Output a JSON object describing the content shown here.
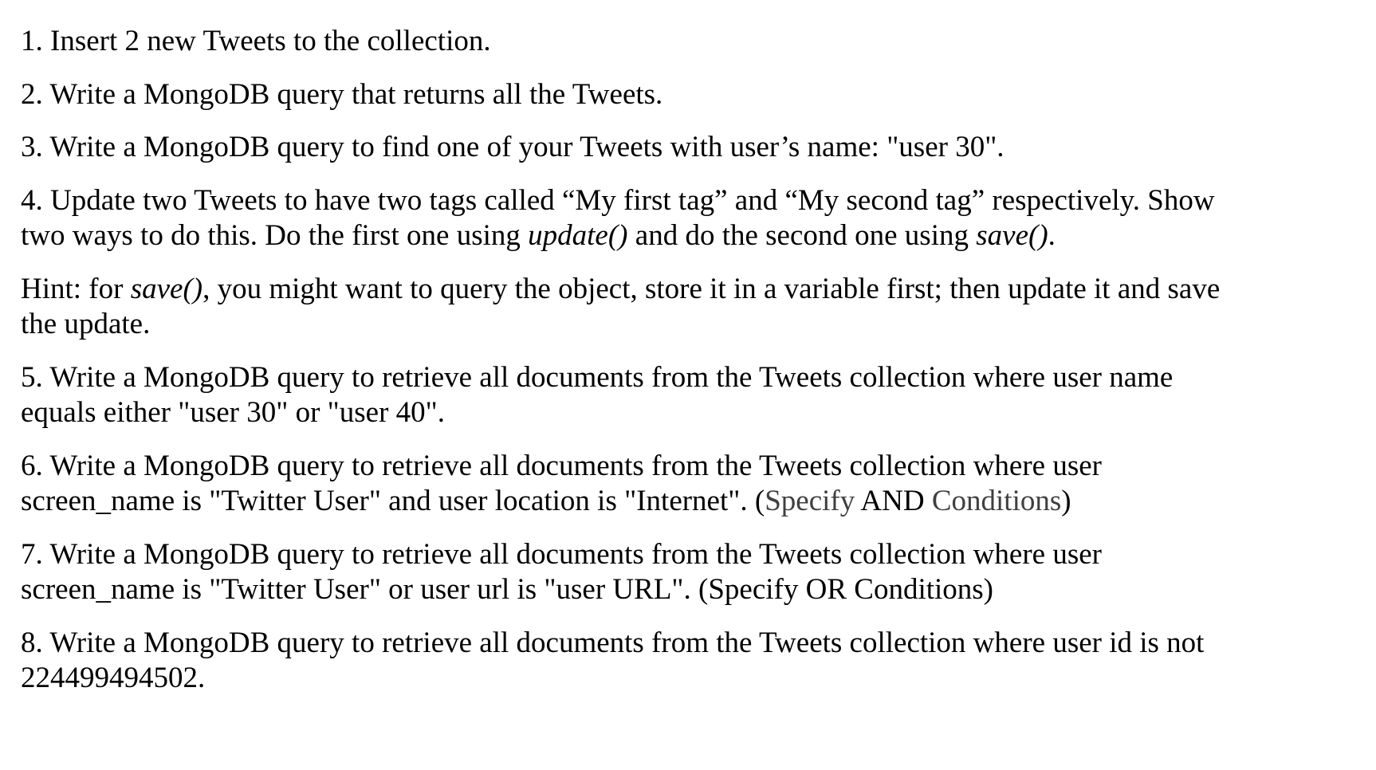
{
  "items": [
    {
      "line1": "1. Insert 2 new Tweets to the collection."
    },
    {
      "line1": "2. Write a MongoDB query that returns all the Tweets."
    },
    {
      "line1": "3. Write a MongoDB query to find one of your Tweets with user’s name: \"user 30\"."
    },
    {
      "line1": "4. Update two Tweets to have two tags called “My first tag” and “My second tag” respectively. Show",
      "line2_a": "two ways to do this. Do the first one using ",
      "line2_em1": "update()",
      "line2_b": " and do the second one using ",
      "line2_em2": "save()",
      "line2_c": "."
    },
    {
      "line1_a": "Hint: for ",
      "line1_em": "save()",
      "line1_b": ", you might want to query the object, store it in a variable first; then update it and save",
      "line2": "the update."
    },
    {
      "line1": "5. Write a MongoDB query to retrieve all documents from the Tweets collection where user name",
      "line2": "equals either \"user 30\" or \"user 40\"."
    },
    {
      "line1": "6. Write a MongoDB query to retrieve all documents from the Tweets collection where user",
      "line2_a": "screen_name is \"Twitter User\" and user location is \"Internet\". (",
      "line2_grey1": "Specify",
      "line2_b": " AND ",
      "line2_grey2": "Conditions",
      "line2_c": ")"
    },
    {
      "line1": "7. Write a MongoDB query to retrieve all documents from the Tweets collection where user",
      "line2": "screen_name is \"Twitter User\" or user url is \"user URL\". (Specify OR Conditions)"
    },
    {
      "line1": "8. Write a MongoDB query to retrieve all documents from the Tweets collection where user id is not",
      "line2": "224499494502."
    }
  ]
}
